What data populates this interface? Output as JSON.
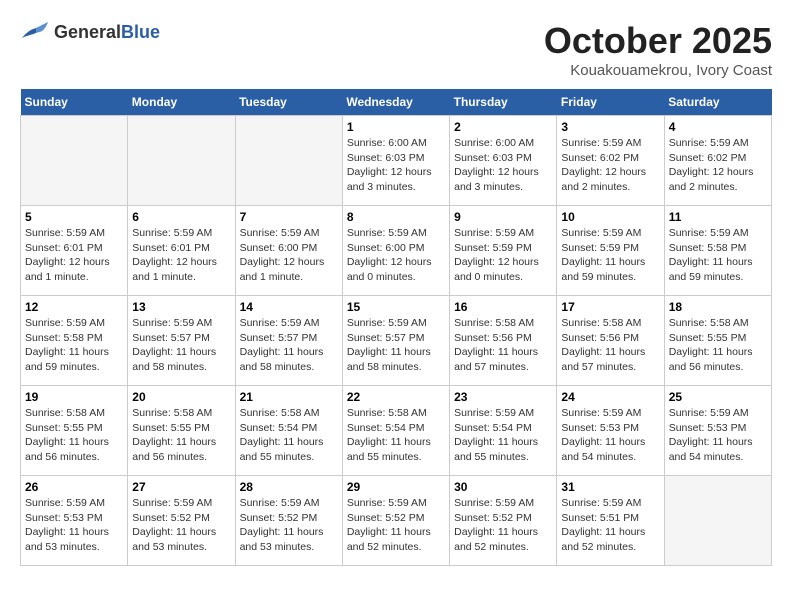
{
  "header": {
    "logo_general": "General",
    "logo_blue": "Blue",
    "month": "October 2025",
    "location": "Kouakouamekrou, Ivory Coast"
  },
  "weekdays": [
    "Sunday",
    "Monday",
    "Tuesday",
    "Wednesday",
    "Thursday",
    "Friday",
    "Saturday"
  ],
  "weeks": [
    [
      {
        "day": "",
        "info": ""
      },
      {
        "day": "",
        "info": ""
      },
      {
        "day": "",
        "info": ""
      },
      {
        "day": "1",
        "info": "Sunrise: 6:00 AM\nSunset: 6:03 PM\nDaylight: 12 hours\nand 3 minutes."
      },
      {
        "day": "2",
        "info": "Sunrise: 6:00 AM\nSunset: 6:03 PM\nDaylight: 12 hours\nand 3 minutes."
      },
      {
        "day": "3",
        "info": "Sunrise: 5:59 AM\nSunset: 6:02 PM\nDaylight: 12 hours\nand 2 minutes."
      },
      {
        "day": "4",
        "info": "Sunrise: 5:59 AM\nSunset: 6:02 PM\nDaylight: 12 hours\nand 2 minutes."
      }
    ],
    [
      {
        "day": "5",
        "info": "Sunrise: 5:59 AM\nSunset: 6:01 PM\nDaylight: 12 hours\nand 1 minute."
      },
      {
        "day": "6",
        "info": "Sunrise: 5:59 AM\nSunset: 6:01 PM\nDaylight: 12 hours\nand 1 minute."
      },
      {
        "day": "7",
        "info": "Sunrise: 5:59 AM\nSunset: 6:00 PM\nDaylight: 12 hours\nand 1 minute."
      },
      {
        "day": "8",
        "info": "Sunrise: 5:59 AM\nSunset: 6:00 PM\nDaylight: 12 hours\nand 0 minutes."
      },
      {
        "day": "9",
        "info": "Sunrise: 5:59 AM\nSunset: 5:59 PM\nDaylight: 12 hours\nand 0 minutes."
      },
      {
        "day": "10",
        "info": "Sunrise: 5:59 AM\nSunset: 5:59 PM\nDaylight: 11 hours\nand 59 minutes."
      },
      {
        "day": "11",
        "info": "Sunrise: 5:59 AM\nSunset: 5:58 PM\nDaylight: 11 hours\nand 59 minutes."
      }
    ],
    [
      {
        "day": "12",
        "info": "Sunrise: 5:59 AM\nSunset: 5:58 PM\nDaylight: 11 hours\nand 59 minutes."
      },
      {
        "day": "13",
        "info": "Sunrise: 5:59 AM\nSunset: 5:57 PM\nDaylight: 11 hours\nand 58 minutes."
      },
      {
        "day": "14",
        "info": "Sunrise: 5:59 AM\nSunset: 5:57 PM\nDaylight: 11 hours\nand 58 minutes."
      },
      {
        "day": "15",
        "info": "Sunrise: 5:59 AM\nSunset: 5:57 PM\nDaylight: 11 hours\nand 58 minutes."
      },
      {
        "day": "16",
        "info": "Sunrise: 5:58 AM\nSunset: 5:56 PM\nDaylight: 11 hours\nand 57 minutes."
      },
      {
        "day": "17",
        "info": "Sunrise: 5:58 AM\nSunset: 5:56 PM\nDaylight: 11 hours\nand 57 minutes."
      },
      {
        "day": "18",
        "info": "Sunrise: 5:58 AM\nSunset: 5:55 PM\nDaylight: 11 hours\nand 56 minutes."
      }
    ],
    [
      {
        "day": "19",
        "info": "Sunrise: 5:58 AM\nSunset: 5:55 PM\nDaylight: 11 hours\nand 56 minutes."
      },
      {
        "day": "20",
        "info": "Sunrise: 5:58 AM\nSunset: 5:55 PM\nDaylight: 11 hours\nand 56 minutes."
      },
      {
        "day": "21",
        "info": "Sunrise: 5:58 AM\nSunset: 5:54 PM\nDaylight: 11 hours\nand 55 minutes."
      },
      {
        "day": "22",
        "info": "Sunrise: 5:58 AM\nSunset: 5:54 PM\nDaylight: 11 hours\nand 55 minutes."
      },
      {
        "day": "23",
        "info": "Sunrise: 5:59 AM\nSunset: 5:54 PM\nDaylight: 11 hours\nand 55 minutes."
      },
      {
        "day": "24",
        "info": "Sunrise: 5:59 AM\nSunset: 5:53 PM\nDaylight: 11 hours\nand 54 minutes."
      },
      {
        "day": "25",
        "info": "Sunrise: 5:59 AM\nSunset: 5:53 PM\nDaylight: 11 hours\nand 54 minutes."
      }
    ],
    [
      {
        "day": "26",
        "info": "Sunrise: 5:59 AM\nSunset: 5:53 PM\nDaylight: 11 hours\nand 53 minutes."
      },
      {
        "day": "27",
        "info": "Sunrise: 5:59 AM\nSunset: 5:52 PM\nDaylight: 11 hours\nand 53 minutes."
      },
      {
        "day": "28",
        "info": "Sunrise: 5:59 AM\nSunset: 5:52 PM\nDaylight: 11 hours\nand 53 minutes."
      },
      {
        "day": "29",
        "info": "Sunrise: 5:59 AM\nSunset: 5:52 PM\nDaylight: 11 hours\nand 52 minutes."
      },
      {
        "day": "30",
        "info": "Sunrise: 5:59 AM\nSunset: 5:52 PM\nDaylight: 11 hours\nand 52 minutes."
      },
      {
        "day": "31",
        "info": "Sunrise: 5:59 AM\nSunset: 5:51 PM\nDaylight: 11 hours\nand 52 minutes."
      },
      {
        "day": "",
        "info": ""
      }
    ]
  ]
}
